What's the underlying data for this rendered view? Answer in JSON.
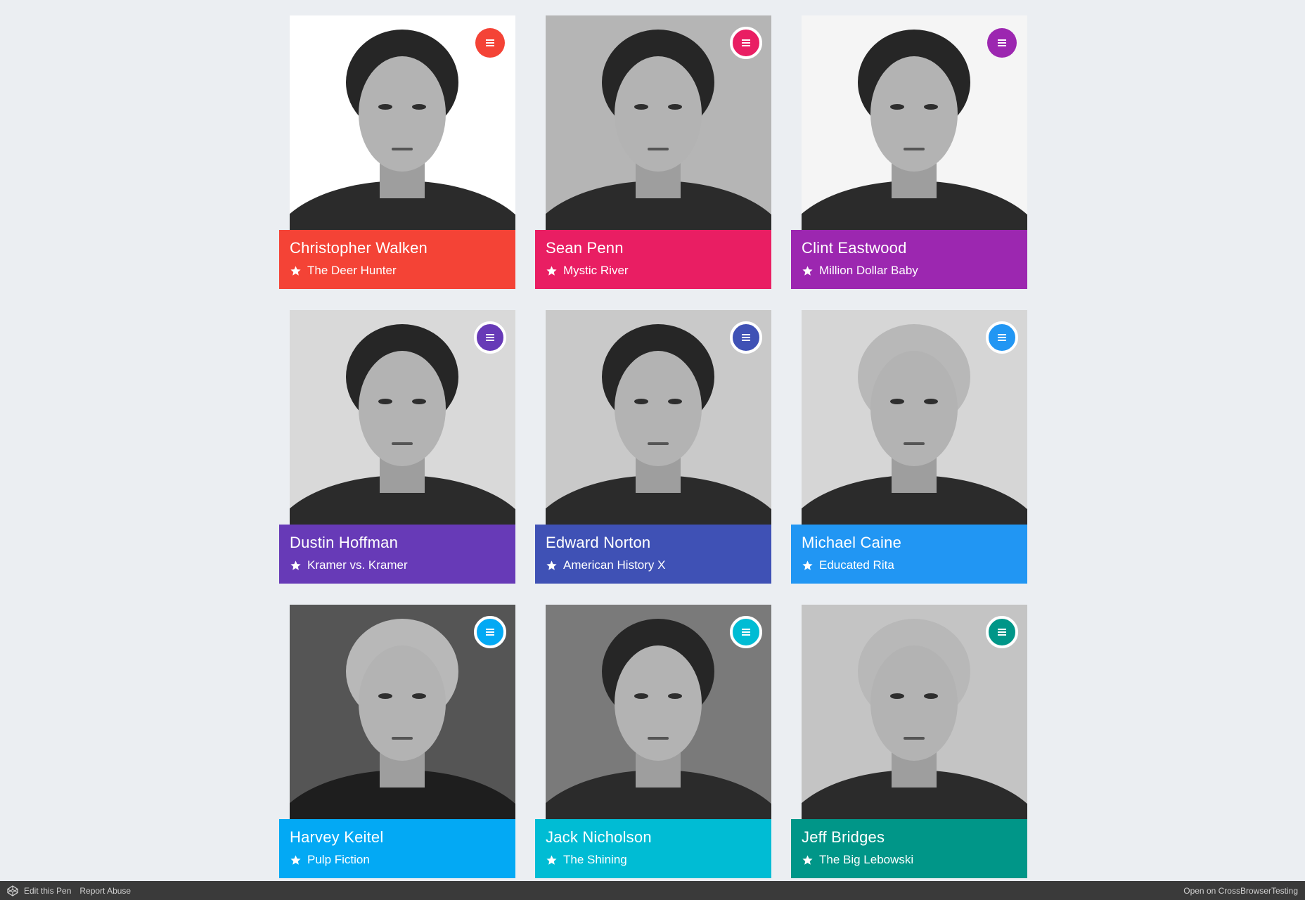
{
  "cards": [
    {
      "name": "Christopher Walken",
      "movie": "The Deer Hunter",
      "color": "#f44336",
      "fold": "#b71c1c",
      "photo_bg": "#ffffff",
      "menu_icon": "menu-icon",
      "bordered": false
    },
    {
      "name": "Sean Penn",
      "movie": "Mystic River",
      "color": "#e91e63",
      "fold": "#880e4f",
      "photo_bg": "#b5b5b5",
      "menu_icon": "menu-icon",
      "bordered": true
    },
    {
      "name": "Clint Eastwood",
      "movie": "Million Dollar Baby",
      "color": "#9c27b0",
      "fold": "#4a148c",
      "photo_bg": "#f5f5f5",
      "menu_icon": "menu-icon",
      "bordered": false
    },
    {
      "name": "Dustin Hoffman",
      "movie": "Kramer vs. Kramer",
      "color": "#673ab7",
      "fold": "#311b92",
      "photo_bg": "#d9d9d9",
      "menu_icon": "menu-icon",
      "bordered": true
    },
    {
      "name": "Edward Norton",
      "movie": "American History X",
      "color": "#3f51b5",
      "fold": "#1a237e",
      "photo_bg": "#c9c9c9",
      "menu_icon": "menu-icon",
      "bordered": true
    },
    {
      "name": "Michael Caine",
      "movie": "Educated Rita",
      "color": "#2196f3",
      "fold": "#0d47a1",
      "photo_bg": "#d6d6d6",
      "menu_icon": "menu-icon",
      "bordered": true
    },
    {
      "name": "Harvey Keitel",
      "movie": "Pulp Fiction",
      "color": "#03a9f4",
      "fold": "#01579b",
      "photo_bg": "#555555",
      "menu_icon": "menu-icon",
      "bordered": true
    },
    {
      "name": "Jack Nicholson",
      "movie": "The Shining",
      "color": "#00bcd4",
      "fold": "#006064",
      "photo_bg": "#7a7a7a",
      "menu_icon": "menu-icon",
      "bordered": true
    },
    {
      "name": "Jeff Bridges",
      "movie": "The Big Lebowski",
      "color": "#009688",
      "fold": "#004d40",
      "photo_bg": "#c4c4c4",
      "menu_icon": "menu-icon",
      "bordered": true
    }
  ],
  "footer": {
    "edit_label": "Edit this Pen",
    "report_label": "Report Abuse",
    "open_label": "Open on CrossBrowserTesting"
  }
}
